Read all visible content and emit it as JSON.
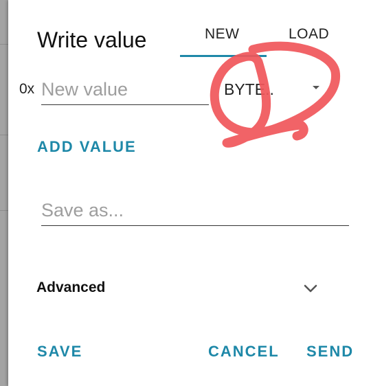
{
  "dialog": {
    "title": "Write value",
    "tabs": [
      {
        "label": "NEW",
        "selected": true
      },
      {
        "label": "LOAD",
        "selected": false
      }
    ],
    "value_field": {
      "prefix": "0x",
      "placeholder": "New value",
      "value": ""
    },
    "type_select": {
      "selected": "BYTE.."
    },
    "add_value_label": "ADD VALUE",
    "save_as_field": {
      "placeholder": "Save as...",
      "value": ""
    },
    "advanced": {
      "label": "Advanced",
      "icon": "chevron-down-icon"
    },
    "actions": {
      "save": "SAVE",
      "cancel": "CANCEL",
      "send": "SEND"
    }
  },
  "colors": {
    "accent": "#1e88a8",
    "annotation": "#f0565a"
  }
}
